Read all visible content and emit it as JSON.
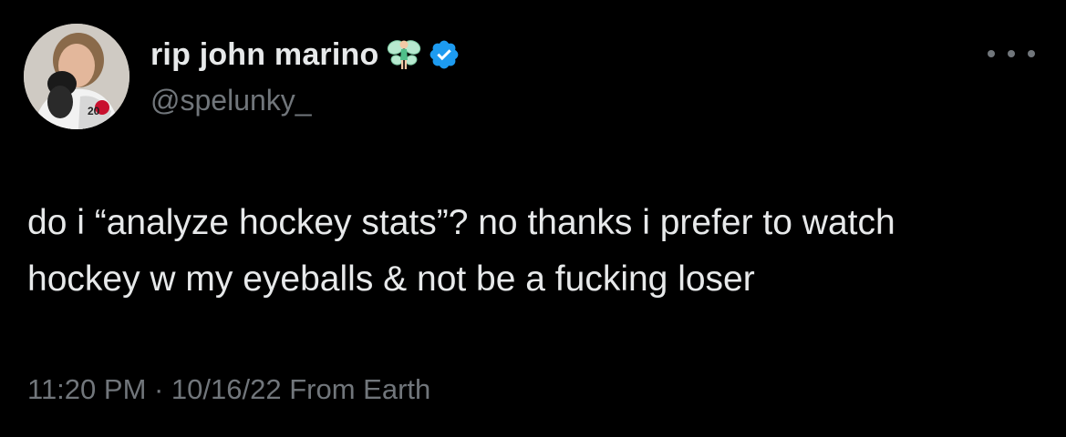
{
  "tweet": {
    "display_name": "rip john marino",
    "name_emoji": "🧚",
    "handle": "@spelunky_",
    "text_line1": "do i “analyze hockey stats”? no thanks i prefer to watch",
    "text_line2": "hockey w my eyeballs & not be a fucking loser",
    "timestamp": "11:20 PM · 10/16/22 From Earth",
    "avatar_jersey_number": "20"
  },
  "icons": {
    "avatar": "avatar-photo",
    "emoji": "fairy-emoji-icon",
    "verified": "verified-badge-icon",
    "more": "more-options-icon"
  },
  "colors": {
    "background": "#000000",
    "primary_text": "#e7e9ea",
    "secondary_text": "#71767b",
    "verified_blue": "#1d9bf0"
  }
}
